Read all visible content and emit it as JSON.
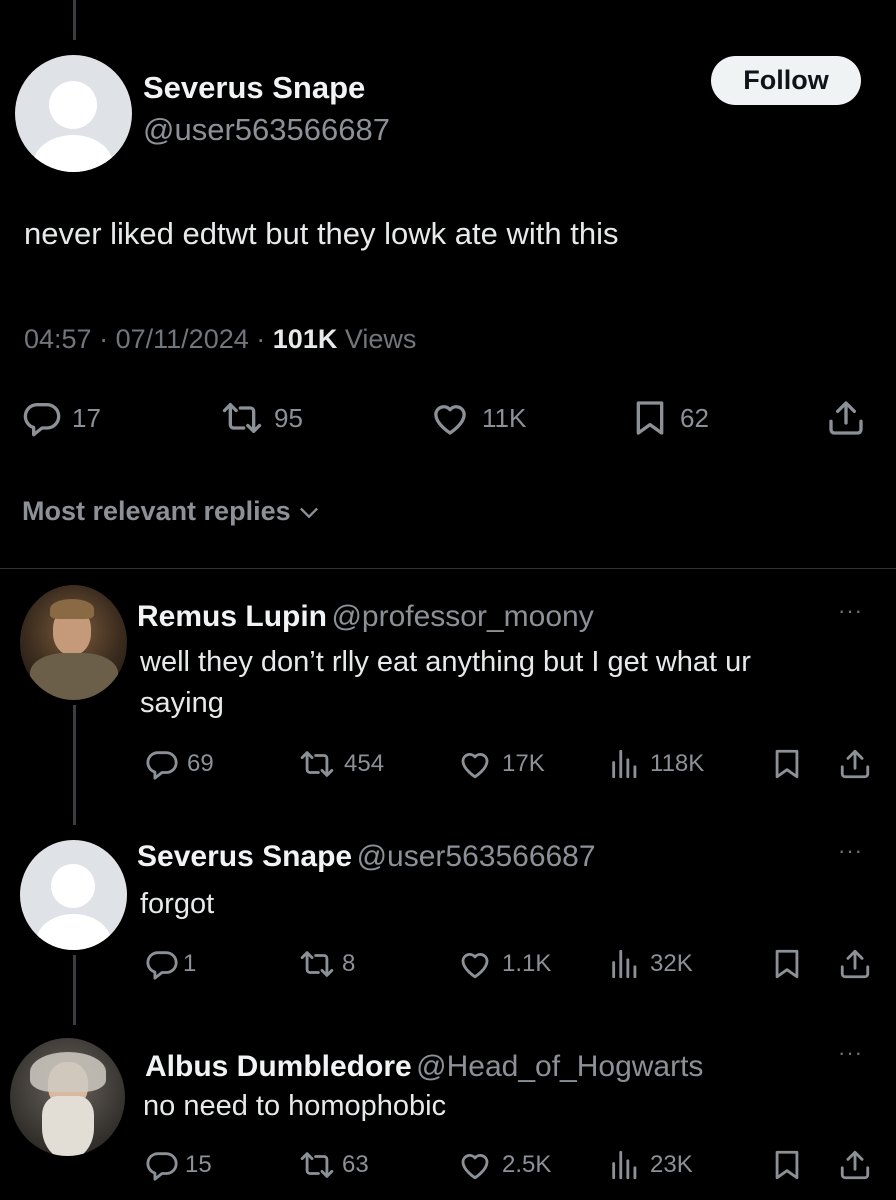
{
  "main_tweet": {
    "author_name": "Severus Snape",
    "author_handle": "@user563566687",
    "follow_label": "Follow",
    "text": "never liked edtwt but they lowk ate with this",
    "time": "04:57",
    "date": "07/11/2024",
    "views_count": "101K",
    "views_label": "Views",
    "separator": "·",
    "stats": {
      "replies": "17",
      "reposts": "95",
      "likes": "11K",
      "bookmarks": "62"
    }
  },
  "replies_sort": {
    "label": "Most relevant replies"
  },
  "replies": [
    {
      "author_name": "Remus Lupin",
      "author_handle": "@professor_moony",
      "text_line1": "well they don’t rlly eat anything but I get what ur",
      "text_line2": "saying",
      "stats": {
        "replies": "69",
        "reposts": "454",
        "likes": "17K",
        "views": "118K"
      },
      "more": "···"
    },
    {
      "author_name": "Severus Snape",
      "author_handle": "@user563566687",
      "text_line1": "forgot",
      "stats": {
        "replies": "1",
        "reposts": "8",
        "likes": "1.1K",
        "views": "32K"
      },
      "more": "···"
    },
    {
      "author_name": "Albus Dumbledore",
      "author_handle": "@Head_of_Hogwarts",
      "text_line1": "no need to homophobic",
      "stats": {
        "replies": "15",
        "reposts": "63",
        "likes": "2.5K",
        "views": "23K"
      },
      "more": "···"
    }
  ],
  "icons": {
    "reply": "reply-bubble-icon",
    "repost": "repost-arrows-icon",
    "like": "heart-icon",
    "bookmark": "bookmark-icon",
    "share": "share-upload-icon",
    "views": "views-bar-chart-icon"
  },
  "colors": {
    "background": "#000000",
    "text": "#e7e9ea",
    "muted": "#71767b",
    "follow_bg": "#eff3f4"
  }
}
